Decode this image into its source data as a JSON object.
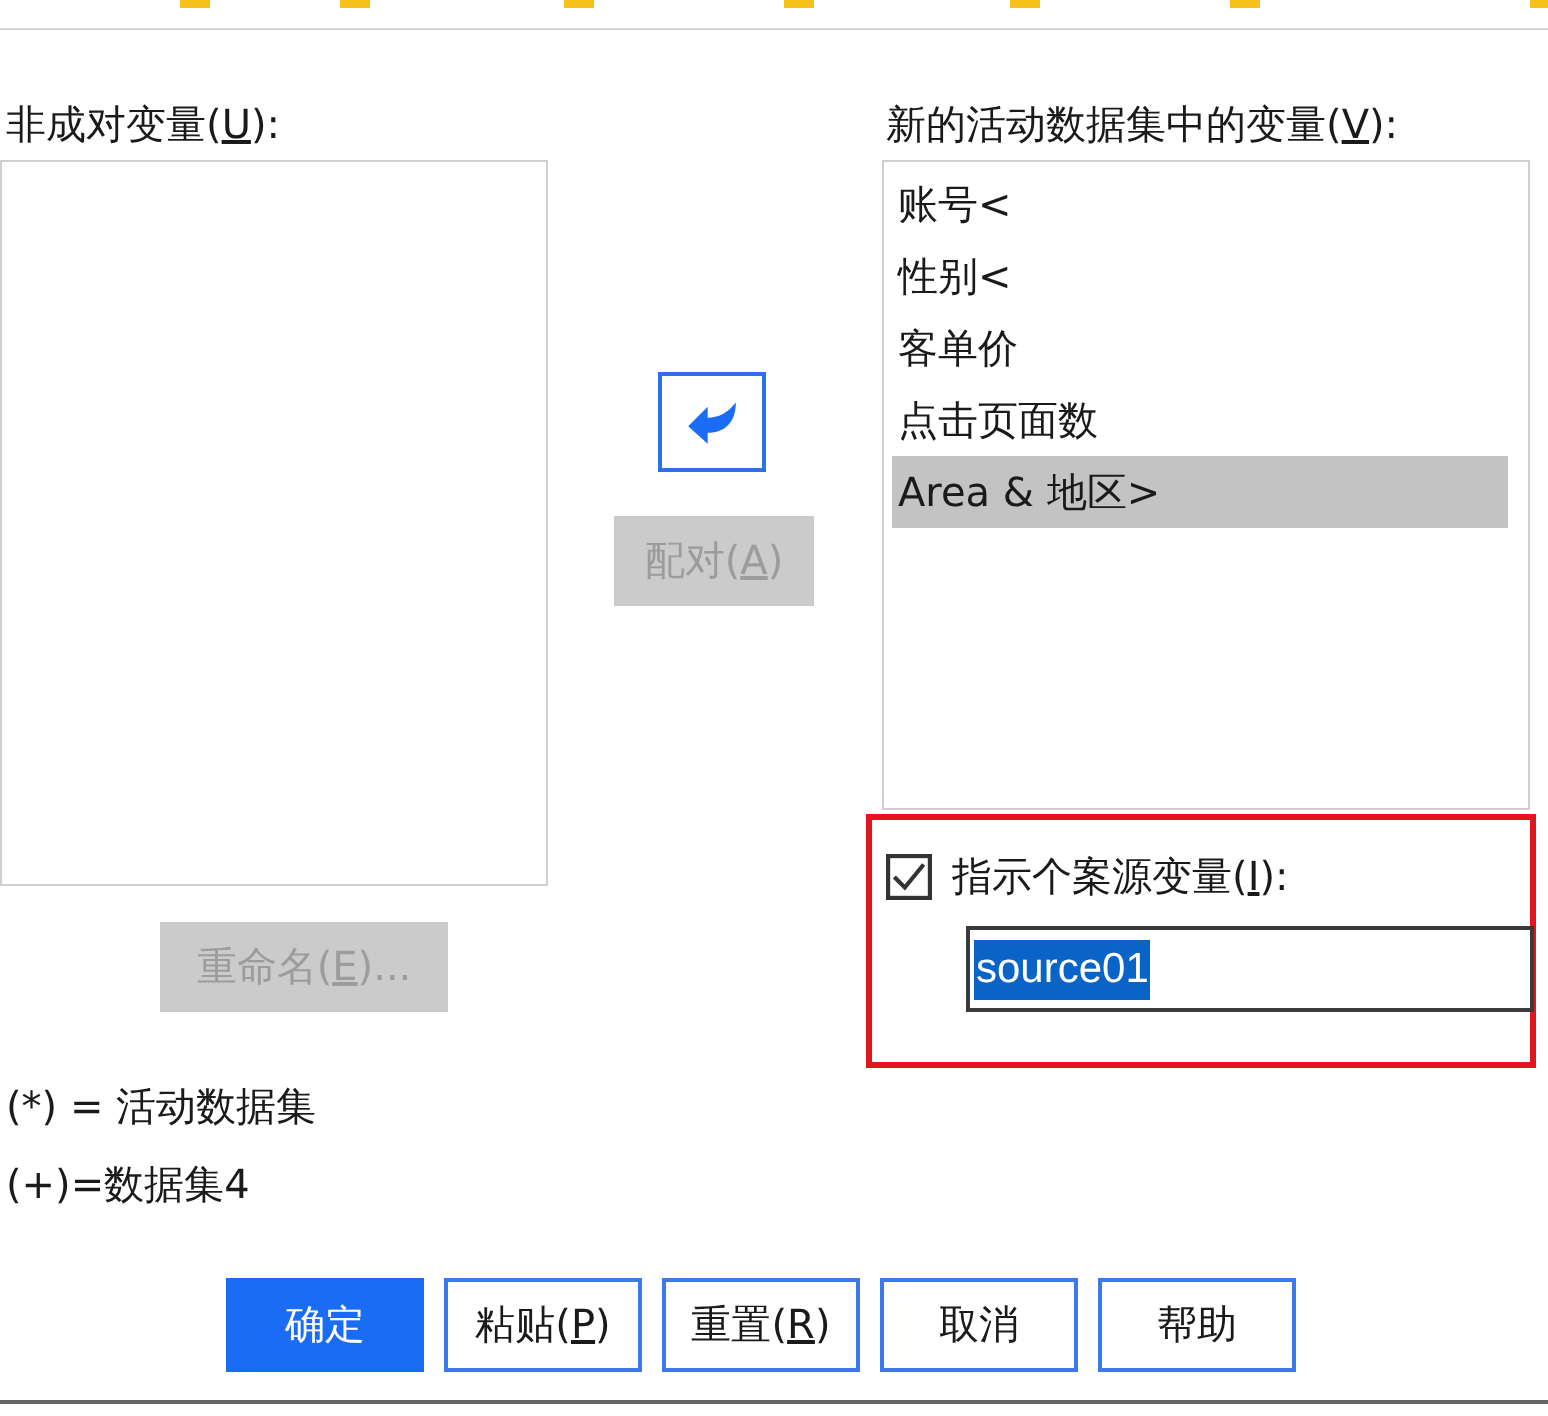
{
  "unpaired_variables": {
    "label": {
      "text": "非成对变量(",
      "access_key": "U",
      "rest": "):"
    },
    "rename_button": {
      "label": {
        "text": "重命名(",
        "access_key": "E",
        "rest": ")..."
      },
      "disabled": true
    }
  },
  "legend": [
    "(*) = 活动数据集",
    "(+)=数据集4"
  ],
  "pair_button": {
    "label": {
      "text": "配对(",
      "access_key": "A",
      "rest": ")"
    },
    "disabled": true
  },
  "new_variables": {
    "label": {
      "text": "新的活动数据集中的变量(",
      "access_key": "V",
      "rest": "):"
    },
    "items": [
      {
        "label": "账号<",
        "selected": false
      },
      {
        "label": "性别<",
        "selected": false
      },
      {
        "label": "客单价",
        "selected": false
      },
      {
        "label": "点击页面数",
        "selected": false
      },
      {
        "label": "Area & 地区>",
        "selected": true
      }
    ]
  },
  "source_indicator": {
    "checked": true,
    "label": {
      "text": "指示个案源变量(",
      "access_key": "I",
      "rest": "):"
    },
    "value": "source01",
    "text_selected": true
  },
  "buttons": [
    {
      "label": {
        "text": "确定"
      },
      "default": true
    },
    {
      "label": {
        "text": "粘贴(",
        "access_key": "P",
        "rest": ")"
      },
      "default": false
    },
    {
      "label": {
        "text": "重置(",
        "access_key": "R",
        "rest": ")"
      },
      "default": false
    },
    {
      "label": {
        "text": "取消"
      },
      "default": false
    },
    {
      "label": {
        "text": "帮助"
      },
      "default": false
    }
  ]
}
